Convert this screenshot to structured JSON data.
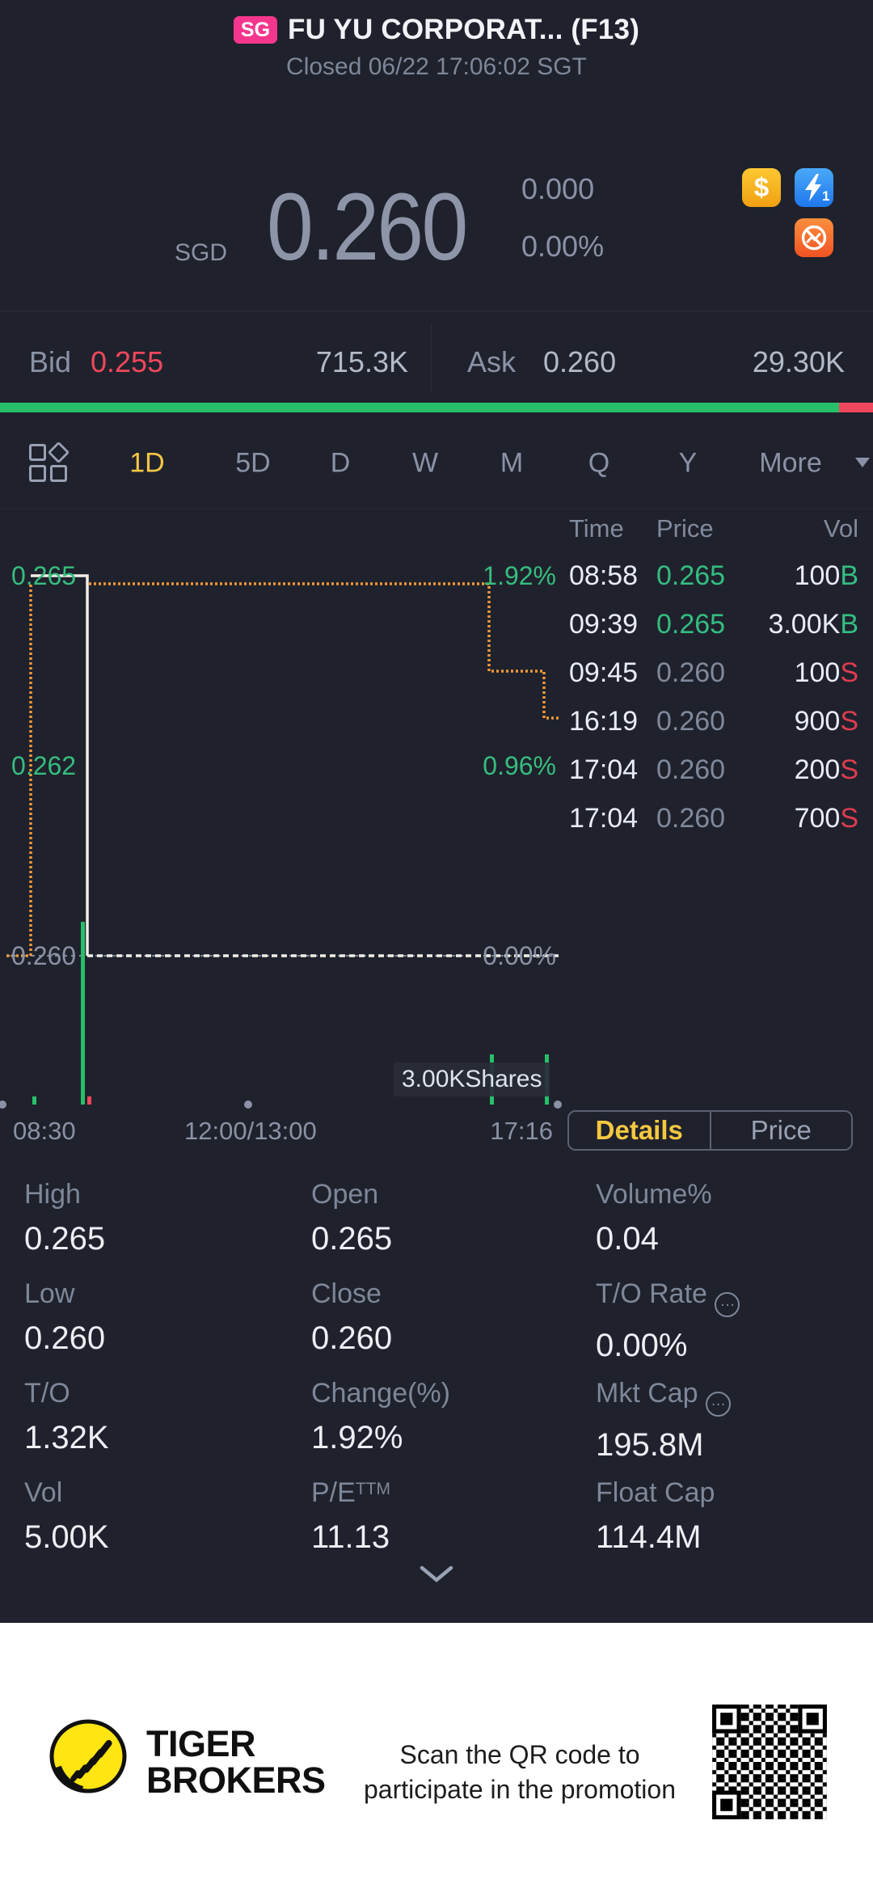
{
  "header": {
    "badge": "SG",
    "title": "FU YU CORPORAT... (F13)",
    "status": "Closed 06/22 17:06:02 SGT"
  },
  "quote": {
    "currency": "SGD",
    "last": "0.260",
    "change": "0.000",
    "change_pct": "0.00%"
  },
  "corner_icons": {
    "dollar": "$",
    "flash_number": "1"
  },
  "bid_ask": {
    "bid_label": "Bid",
    "bid_price": "0.255",
    "bid_size": "715.3K",
    "ask_label": "Ask",
    "ask_price": "0.260",
    "ask_size": "29.30K"
  },
  "tabs": {
    "items": [
      "1D",
      "5D",
      "D",
      "W",
      "M",
      "Q",
      "Y"
    ],
    "more_label": "More"
  },
  "chart": {
    "price_labels": [
      "0.265",
      "0.262",
      "0.260"
    ],
    "pct_labels": [
      "1.92%",
      "0.96%",
      "0.00%"
    ],
    "x_labels": [
      "08:30",
      "12:00/13:00",
      "17:16"
    ],
    "max_vol_label": "3.00KShares"
  },
  "chart_data": {
    "type": "line",
    "title": "Intraday (1D) price chart",
    "x_axis_labels": [
      "08:30",
      "12:00/13:00",
      "17:16"
    ],
    "y_axis_labels": [
      0.265,
      0.262,
      0.26
    ],
    "pct_axis_labels": [
      "1.92%",
      "0.96%",
      "0.00%"
    ],
    "baseline_prev_close": 0.26,
    "ylim": [
      0.26,
      0.265
    ],
    "series": [
      {
        "name": "price",
        "color": "#f1eee7",
        "points": [
          [
            "08:58",
            0.265
          ],
          [
            "09:45",
            0.265
          ],
          [
            "09:45",
            0.26
          ],
          [
            "17:16",
            0.26
          ]
        ]
      },
      {
        "name": "average",
        "color": "#f0973a",
        "points": [
          [
            "08:58",
            0.265
          ],
          [
            "16:19",
            0.265
          ],
          [
            "16:19",
            0.2637
          ],
          [
            "17:04",
            0.2637
          ],
          [
            "17:04",
            0.2625
          ],
          [
            "17:16",
            0.2625
          ]
        ]
      }
    ],
    "volume_bars": [
      {
        "time": "08:58",
        "volume": 100,
        "side": "B"
      },
      {
        "time": "09:39",
        "volume": 3000,
        "side": "B"
      },
      {
        "time": "09:45",
        "volume": 100,
        "side": "S"
      },
      {
        "time": "16:19",
        "volume": 900,
        "side": "S"
      },
      {
        "time": "17:04",
        "volume": 900,
        "side": "S"
      }
    ],
    "max_volume_label": "3.00KShares"
  },
  "trades": {
    "headers": [
      "Time",
      "Price",
      "Vol"
    ],
    "rows": [
      {
        "time": "08:58",
        "price": "0.265",
        "vol": "100",
        "side": "B"
      },
      {
        "time": "09:39",
        "price": "0.265",
        "vol": "3.00K",
        "side": "B"
      },
      {
        "time": "09:45",
        "price": "0.260",
        "vol": "100",
        "side": "S"
      },
      {
        "time": "16:19",
        "price": "0.260",
        "vol": "900",
        "side": "S"
      },
      {
        "time": "17:04",
        "price": "0.260",
        "vol": "200",
        "side": "S"
      },
      {
        "time": "17:04",
        "price": "0.260",
        "vol": "700",
        "side": "S"
      }
    ]
  },
  "toggle": {
    "details": "Details",
    "price": "Price"
  },
  "stats": {
    "cells": [
      {
        "label": "High",
        "value": "0.265"
      },
      {
        "label": "Open",
        "value": "0.265"
      },
      {
        "label": "Volume%",
        "value": "0.04"
      },
      {
        "label": "Low",
        "value": "0.260"
      },
      {
        "label": "Close",
        "value": "0.260"
      },
      {
        "label": "T/O Rate",
        "value": "0.00%"
      },
      {
        "label": "T/O",
        "value": "1.32K"
      },
      {
        "label": "Change(%)",
        "value": "1.92%"
      },
      {
        "label": "Mkt Cap",
        "value": "195.8M"
      },
      {
        "label": "Vol",
        "value": "5.00K"
      },
      {
        "label": "P/E",
        "sup": "TTM",
        "value": "11.13"
      },
      {
        "label": "Float Cap",
        "value": "114.4M"
      }
    ]
  },
  "footer": {
    "brand_top": "TIGER",
    "brand_bottom": "BROKERS",
    "promo_line1": "Scan the QR code to",
    "promo_line2": "participate in the promotion"
  },
  "colors": {
    "background": "#1f222c",
    "accent_yellow": "#f6c644",
    "green": "#34bd82",
    "bar_green": "#27c069",
    "red": "#f0475c",
    "orange_line": "#f0973a",
    "white_line": "#f1eee7",
    "badge_pink": "#f4378d"
  }
}
